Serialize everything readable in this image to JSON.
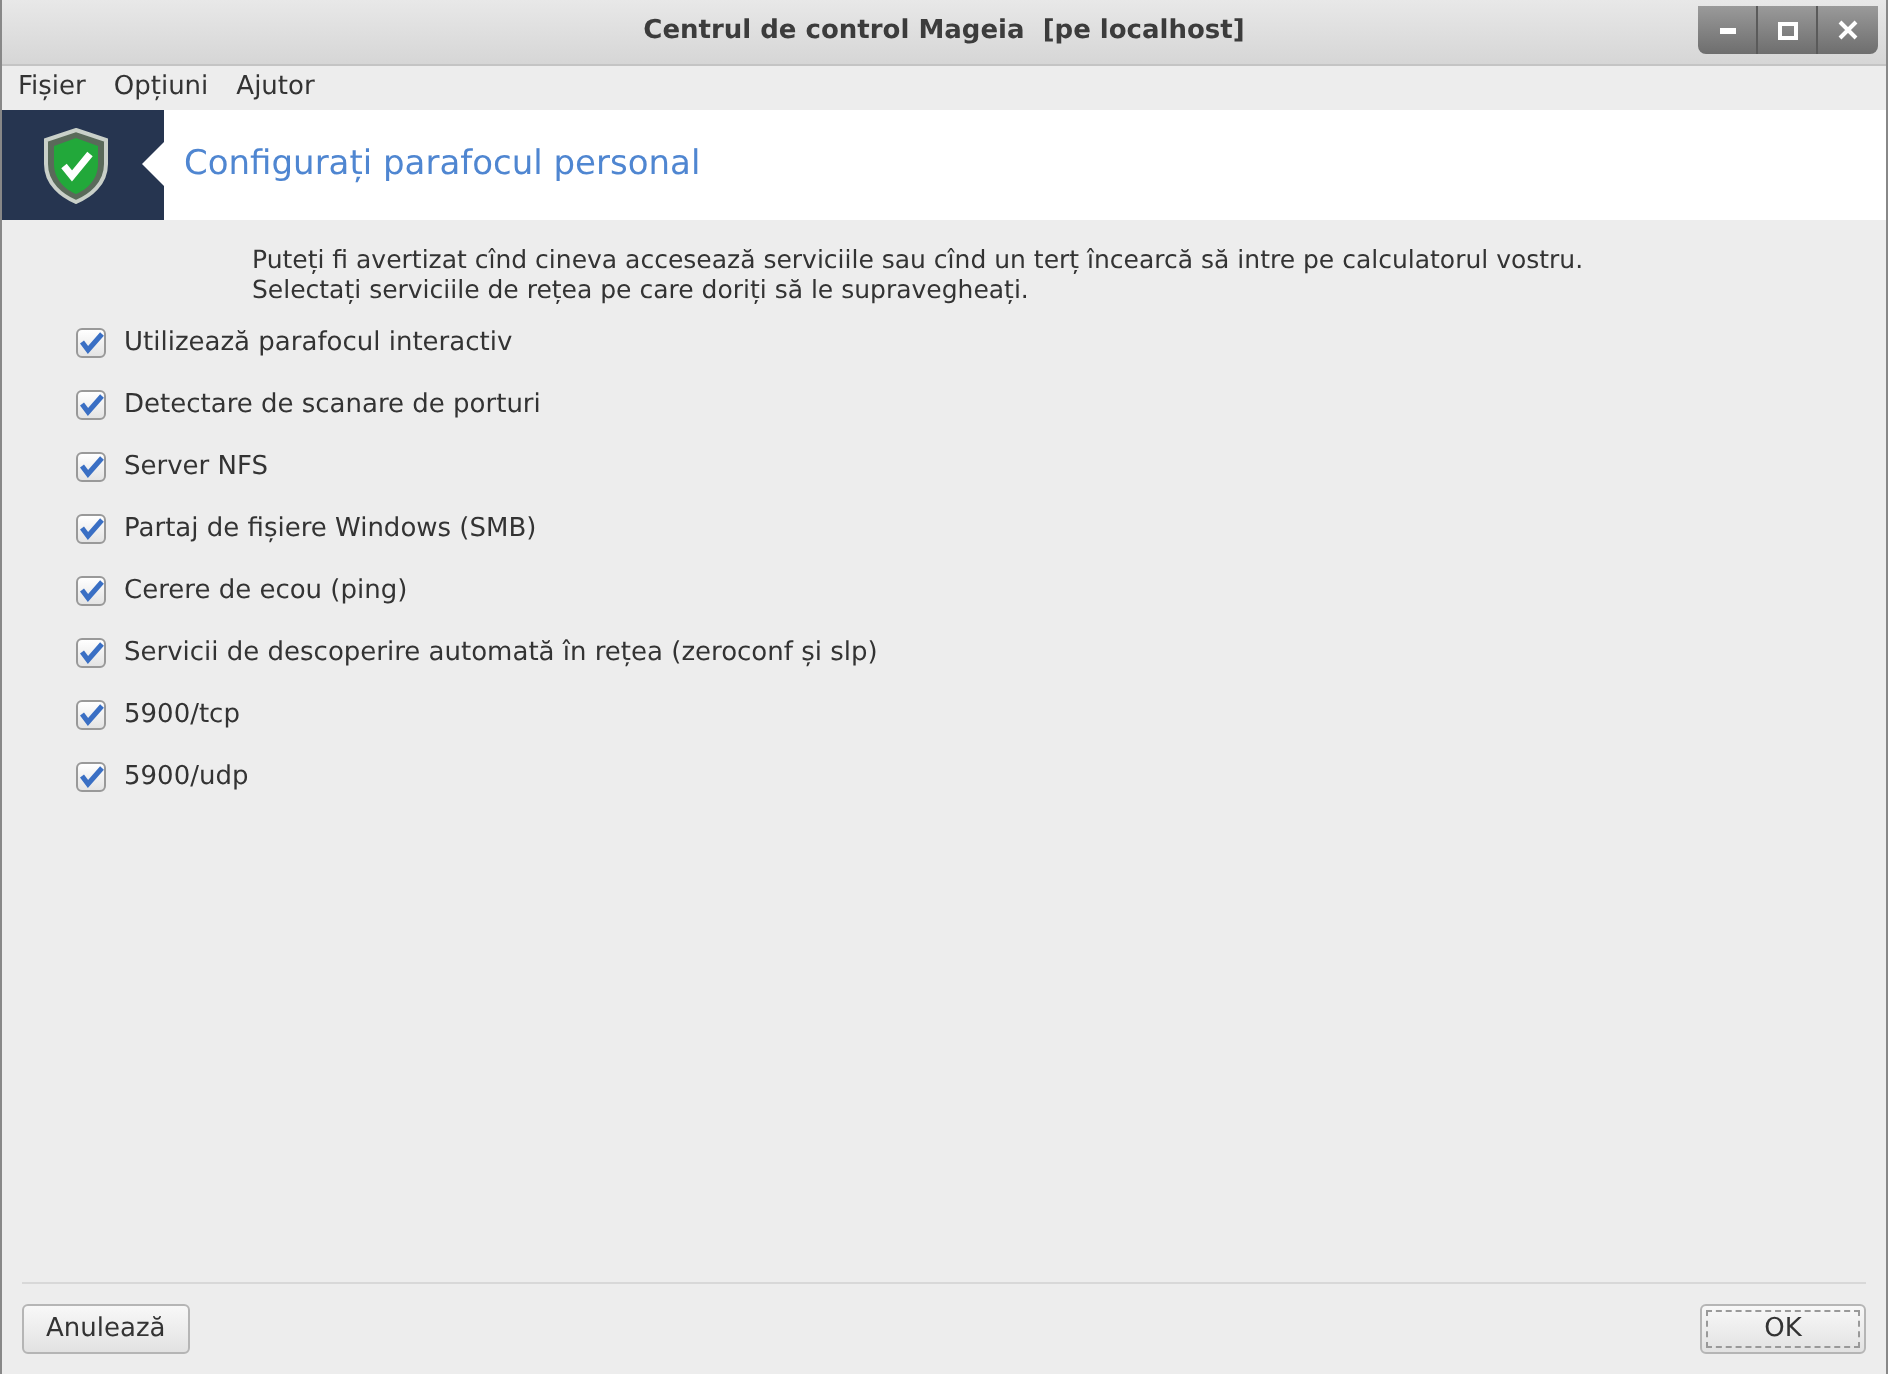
{
  "window": {
    "title": "Centrul de control Mageia  [pe localhost]"
  },
  "menu": [
    "Fișier",
    "Opțiuni",
    "Ajutor"
  ],
  "header": {
    "title": "Configurați parafocul personal"
  },
  "description": [
    "Puteți fi avertizat cînd cineva accesează serviciile sau cînd un terț încearcă să intre pe calculatorul vostru.",
    "Selectați serviciile de rețea pe care doriți să le supravegheați."
  ],
  "options": [
    {
      "label": "Utilizează parafocul interactiv",
      "checked": true
    },
    {
      "label": "Detectare de scanare de porturi",
      "checked": true
    },
    {
      "label": "Server NFS",
      "checked": true
    },
    {
      "label": "Partaj de fișiere Windows (SMB)",
      "checked": true
    },
    {
      "label": "Cerere de ecou (ping)",
      "checked": true
    },
    {
      "label": "Servicii de descoperire automată în rețea (zeroconf și slp)",
      "checked": true
    },
    {
      "label": "5900/tcp",
      "checked": true
    },
    {
      "label": "5900/udp",
      "checked": true
    }
  ],
  "buttons": {
    "cancel": "Anulează",
    "ok": "OK"
  }
}
